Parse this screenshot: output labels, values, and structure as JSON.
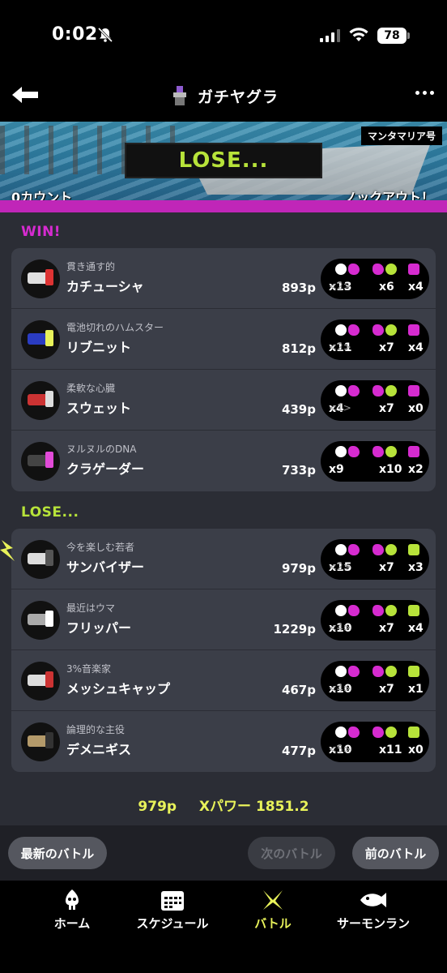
{
  "status_bar": {
    "time": "0:02",
    "battery": "78"
  },
  "header": {
    "title": "ガチヤグラ"
  },
  "banner": {
    "stage": "マンタマリア号",
    "result": "LOSE...",
    "count_left": "0カウント",
    "count_right": "ノックアウト！"
  },
  "win_team": {
    "label": "WIN!",
    "players": [
      {
        "title": "貫き通す的",
        "name": "カチューシャ",
        "points": "893p",
        "kills": "x13",
        "assists": "<2>",
        "specials_k": "x6",
        "specials": "x4"
      },
      {
        "title": "電池切れのハムスター",
        "name": "リブニット",
        "points": "812p",
        "kills": "x11",
        "assists": "<2>",
        "specials_k": "x7",
        "specials": "x4"
      },
      {
        "title": "柔軟な心臓",
        "name": "スウェット",
        "points": "439p",
        "kills": "x4",
        "assists": "<1>",
        "specials_k": "x7",
        "specials": "x0"
      },
      {
        "title": "ヌルヌルのDNA",
        "name": "クラゲーダー",
        "points": "733p",
        "kills": "x9",
        "assists": "",
        "specials_k": "x10",
        "specials": "x2"
      }
    ]
  },
  "lose_team": {
    "label": "LOSE...",
    "players": [
      {
        "title": "今を楽しむ若者",
        "name": "サンバイザー",
        "points": "979p",
        "kills": "x15",
        "assists": "<2>",
        "specials_k": "x7",
        "specials": "x3"
      },
      {
        "title": "最近はウマ",
        "name": "フリッパー",
        "points": "1229p",
        "kills": "x10",
        "assists": "<4>",
        "specials_k": "x7",
        "specials": "x4"
      },
      {
        "title": "3%音楽家",
        "name": "メッシュキャップ",
        "points": "467p",
        "kills": "x10",
        "assists": "<4>",
        "specials_k": "x7",
        "specials": "x1"
      },
      {
        "title": "論理的な主役",
        "name": "デメニギス",
        "points": "477p",
        "kills": "x10",
        "assists": "<5>",
        "specials_k": "x11",
        "specials": "x0"
      }
    ]
  },
  "summary": {
    "points": "979p",
    "xpower": "Xパワー 1851.2"
  },
  "nav": {
    "latest": "最新のバトル",
    "next": "次のバトル",
    "prev": "前のバトル"
  },
  "tabs": [
    {
      "label": "ホーム",
      "icon": "squid-icon"
    },
    {
      "label": "スケジュール",
      "icon": "calendar-icon"
    },
    {
      "label": "バトル",
      "icon": "battle-icon"
    },
    {
      "label": "サーモンラン",
      "icon": "salmon-icon"
    }
  ],
  "colors": {
    "win": "#d62bd0",
    "lose": "#b7e33a",
    "accent": "#e8f25a",
    "bg": "#2b2d35",
    "card": "#3b3e48"
  }
}
